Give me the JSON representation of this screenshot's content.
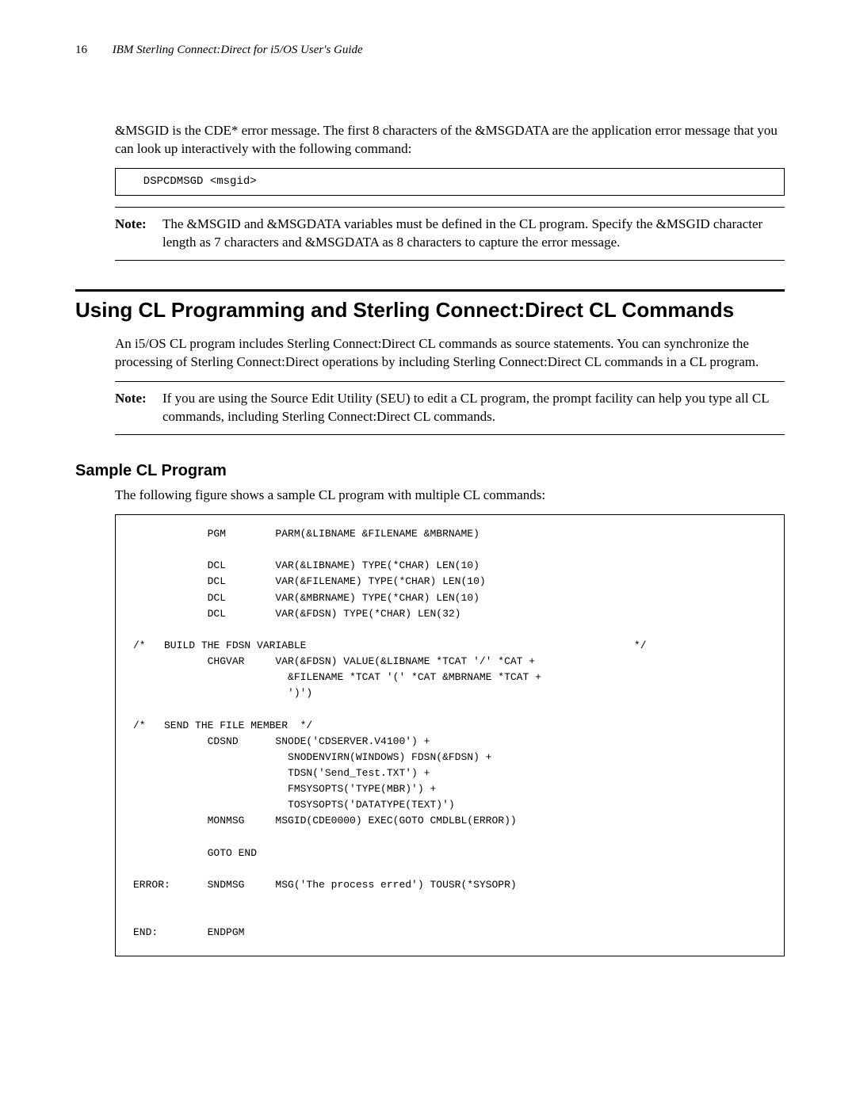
{
  "header": {
    "page_number": "16",
    "running_title": "IBM Sterling Connect:Direct for i5/OS User's Guide"
  },
  "intro_para": "&MSGID is the CDE* error message. The first 8 characters of the &MSGDATA are the application error message that you can look up interactively with the following command:",
  "code1": "  DSPCDMSGD <msgid>",
  "note1": {
    "label": "Note:",
    "text": "The &MSGID and &MSGDATA variables must be defined in the CL program. Specify the &MSGID character length as 7 characters and &MSGDATA as 8 characters to capture the error message."
  },
  "section_heading": "Using CL Programming and Sterling Connect:Direct CL Commands",
  "section_para": "An i5/OS CL program includes Sterling Connect:Direct CL commands as source statements. You can synchronize the processing of Sterling Connect:Direct operations by including Sterling Connect:Direct CL commands in a CL program.",
  "note2": {
    "label": "Note:",
    "text": "If you are using the Source Edit Utility (SEU) to edit a CL program, the prompt facility can help you type all CL commands, including Sterling Connect:Direct CL commands."
  },
  "subsection_heading": "Sample CL Program",
  "subsection_para": "The following figure shows a sample CL program with multiple CL commands:",
  "code2": "            PGM        PARM(&LIBNAME &FILENAME &MBRNAME)\n\n            DCL        VAR(&LIBNAME) TYPE(*CHAR) LEN(10)\n            DCL        VAR(&FILENAME) TYPE(*CHAR) LEN(10)\n            DCL        VAR(&MBRNAME) TYPE(*CHAR) LEN(10)\n            DCL        VAR(&FDSN) TYPE(*CHAR) LEN(32)\n\n/*   BUILD THE FDSN VARIABLE                                                     */\n            CHGVAR     VAR(&FDSN) VALUE(&LIBNAME *TCAT '/' *CAT +\n                         &FILENAME *TCAT '(' *CAT &MBRNAME *TCAT +\n                         ')')\n\n/*   SEND THE FILE MEMBER  */\n            CDSND      SNODE('CDSERVER.V4100') +\n                         SNODENVIRN(WINDOWS) FDSN(&FDSN) +\n                         TDSN('Send_Test.TXT') +\n                         FMSYSOPTS('TYPE(MBR)') +\n                         TOSYSOPTS('DATATYPE(TEXT)')\n            MONMSG     MSGID(CDE0000) EXEC(GOTO CMDLBL(ERROR))\n\n            GOTO END\n\nERROR:      SNDMSG     MSG('The process erred') TOUSR(*SYSOPR)\n\n\nEND:        ENDPGM"
}
